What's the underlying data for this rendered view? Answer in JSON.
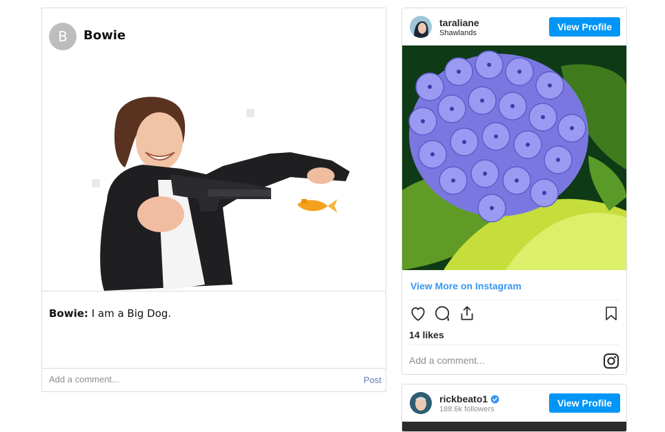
{
  "post": {
    "avatar_initial": "B",
    "username": "Bowie",
    "caption_user": "Bowie:",
    "caption_text": " I am a Big Dog.",
    "comment_placeholder": "Add a comment...",
    "post_label": "Post"
  },
  "ig_embed_1": {
    "username": "taraliane",
    "location": "Shawlands",
    "view_profile_label": "View Profile",
    "view_more_label": "View More on Instagram",
    "likes": "14 likes",
    "comment_placeholder": "Add a comment..."
  },
  "ig_embed_2": {
    "username": "rickbeato1",
    "followers": "188.6k followers",
    "view_profile_label": "View Profile"
  },
  "colors": {
    "accent_blue": "#0095f6",
    "link_blue": "#3897f0",
    "post_link": "#5c7bb3",
    "border": "#dbdbdb"
  }
}
